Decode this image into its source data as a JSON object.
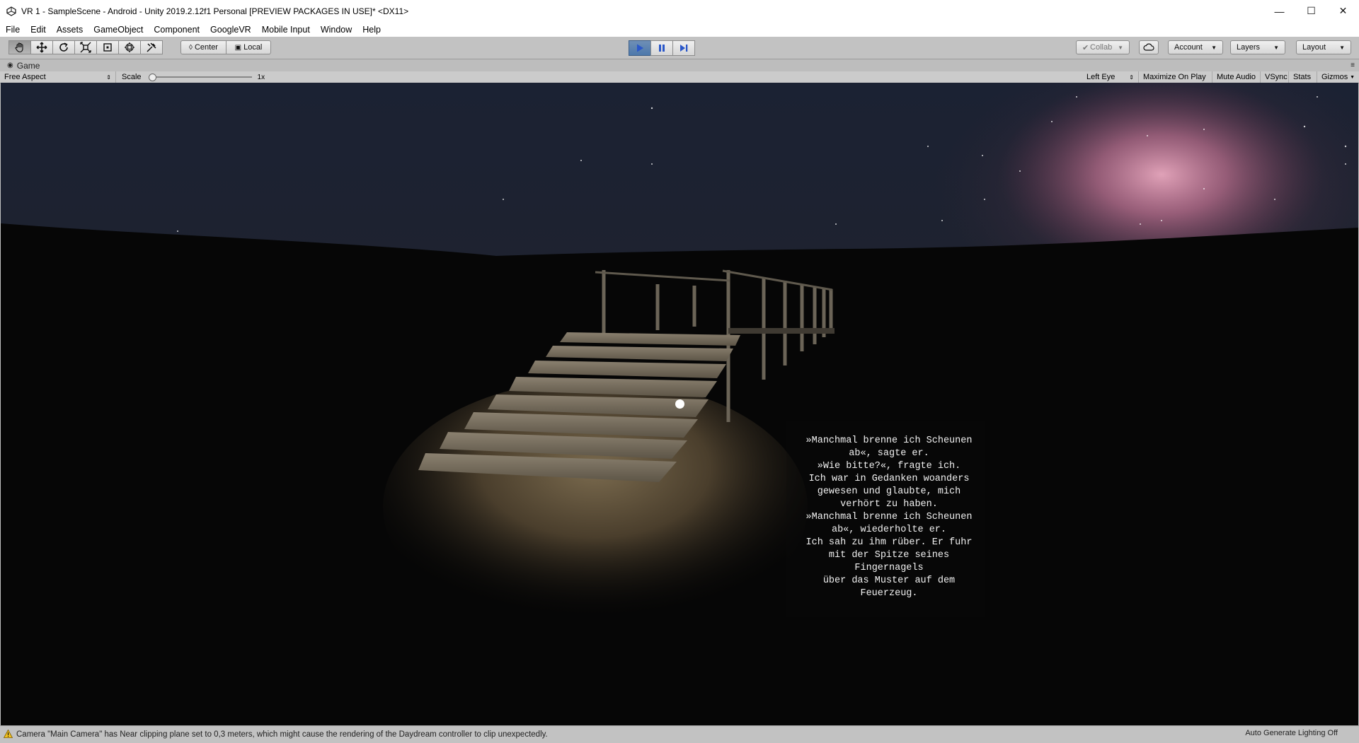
{
  "window": {
    "title": "VR 1 - SampleScene - Android - Unity 2019.2.12f1 Personal [PREVIEW PACKAGES IN USE]* <DX11>",
    "controls": [
      "minimize-icon",
      "maximize-icon",
      "close-icon"
    ]
  },
  "menu": [
    "File",
    "Edit",
    "Assets",
    "GameObject",
    "Component",
    "GoogleVR",
    "Mobile Input",
    "Window",
    "Help"
  ],
  "toolbar": {
    "tools": [
      "hand-tool-icon",
      "move-tool-icon",
      "rotate-tool-icon",
      "scale-tool-icon",
      "rect-tool-icon",
      "transform-tool-icon",
      "custom-tool-icon"
    ],
    "pivot_label": "Center",
    "space_label": "Local",
    "play_icons": [
      "play-icon",
      "pause-icon",
      "step-icon"
    ],
    "collab_label": "Collab",
    "account_label": "Account",
    "layers_label": "Layers",
    "layout_label": "Layout"
  },
  "game_view": {
    "tab_label": "Game",
    "aspect_label": "Free Aspect",
    "scale_label": "Scale",
    "scale_value": "1x",
    "eye_label": "Left Eye",
    "maximize_label": "Maximize On Play",
    "mute_label": "Mute Audio",
    "vsync_label": "VSync",
    "stats_label": "Stats",
    "gizmos_label": "Gizmos"
  },
  "scene_text": "»Manchmal brenne ich Scheunen\nab«, sagte er.\n»Wie bitte?«, fragte ich.\nIch war in Gedanken woanders\ngewesen und glaubte, mich\nverhört zu haben.\n»Manchmal brenne ich Scheunen\nab«, wiederholte er.\nIch sah zu ihm rüber. Er fuhr\nmit der Spitze seines\nFingernagels\nüber das Muster auf dem\nFeuerzeug.",
  "status": {
    "message": "Camera \"Main Camera\" has Near clipping plane set to 0,3 meters, which might cause the rendering of the Daydream controller to clip unexpectedly.",
    "right": "Auto Generate Lighting Off"
  },
  "colors": {
    "play_active": "#4d78ab",
    "editor_bg": "#c2c2c2",
    "nebula": "#d48aa8",
    "sky": "#1b2233"
  }
}
